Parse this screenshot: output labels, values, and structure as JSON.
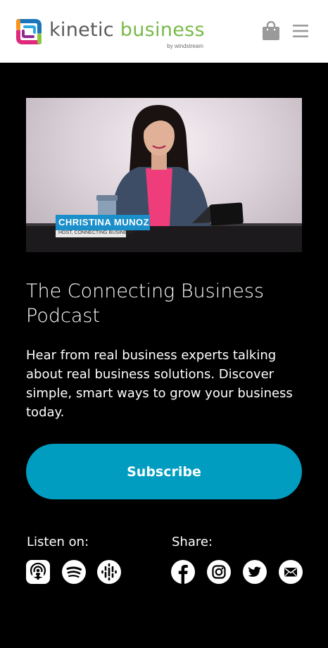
{
  "header": {
    "brand": {
      "word1": "kinetic",
      "word2": "business",
      "byline": "by windstream"
    },
    "bag_icon": "shopping-bag-icon",
    "menu_icon": "hamburger-menu-icon"
  },
  "video": {
    "lower_third_name": "CHRISTINA MUNOZ",
    "lower_third_role": "HOST, CONNECTING BUSINESS"
  },
  "podcast": {
    "title": "The Connecting Business Podcast",
    "description": "Hear from real business experts talking about real business solutions. Discover simple, smart ways to grow your business today.",
    "subscribe_label": "Subscribe"
  },
  "listen": {
    "label": "Listen on:",
    "icons": [
      "apple-podcasts-icon",
      "spotify-icon",
      "google-podcasts-icon"
    ]
  },
  "share": {
    "label": "Share:",
    "icons": [
      "facebook-icon",
      "instagram-icon",
      "twitter-icon",
      "email-icon"
    ]
  },
  "colors": {
    "accent": "#009dc0",
    "brand_green": "#79b94a",
    "brand_gray": "#58595b",
    "background": "#000000"
  }
}
